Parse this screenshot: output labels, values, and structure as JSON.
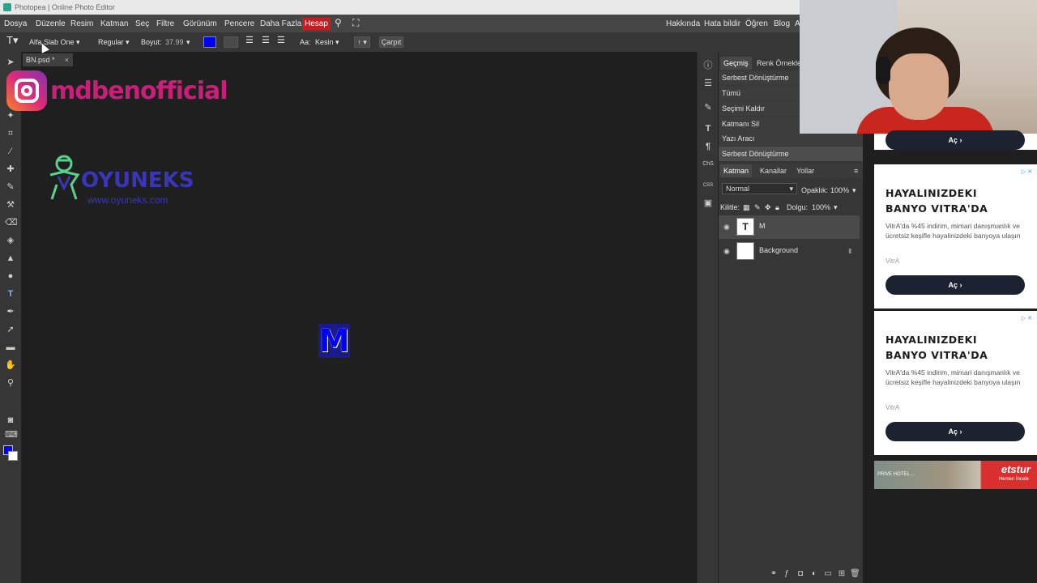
{
  "window": {
    "title": "Photopea | Online Photo Editor"
  },
  "menu": {
    "items": [
      "Dosya",
      "Düzenle",
      "Resim",
      "Katman",
      "Seç",
      "Filtre",
      "Görünüm",
      "Pencere",
      "Daha Fazla",
      "Hesap"
    ],
    "right_items": [
      "Hakkında",
      "Hata bildir",
      "Öğren",
      "Blog",
      "A"
    ],
    "active_color": "#c41e23"
  },
  "options": {
    "font": "Alfa Slab One",
    "style": "Regular",
    "size_label": "Boyut:",
    "size_value": "37.99",
    "text_color": "#0000ff",
    "more": "...",
    "aa_label": "Aa:",
    "aa_value": "Kesin",
    "warp_value": "↑",
    "cancel": "Çarpıt"
  },
  "document": {
    "tab_name": "BN.psd *",
    "close": "×",
    "canvas_text": "M",
    "text_color": "#0000ff"
  },
  "watermark": {
    "instagram": "mdbenofficial",
    "logo_name": "OYUNEKS",
    "logo_url": "www.oyuneks.com"
  },
  "panels": {
    "top_tabs": [
      "Geçmiş",
      "Renk Örnekle"
    ],
    "history": [
      "Serbest Dönüştürme",
      "Tümü",
      "Seçimi Kaldır",
      "Katmanı Sil",
      "Yazı Aracı",
      "Serbest Dönüştürme"
    ],
    "layer_tabs": [
      "Katman",
      "Kanallar",
      "Yollar"
    ],
    "blend_mode": "Normal",
    "opacity_label": "Opaklık:",
    "opacity_value": "100%",
    "lock_label": "Kilitle:",
    "fill_label": "Dolgu:",
    "fill_value": "100%",
    "layers": [
      {
        "name": "M",
        "type": "text",
        "selected": true
      },
      {
        "name": "Background",
        "type": "raster",
        "locked": true
      }
    ]
  },
  "ads": [
    {
      "title": "HAYALINIZDEKI\nBANYO VITRA'DA",
      "desc": "VitrA'da %45 indirim, mimari danışmanlık ve ücretsiz keşifle hayalinizdeki banyoya ulaşın",
      "brand": "VitrA",
      "cta": "Aç"
    },
    {
      "title": "HAYALINIZDEKI\nBANYO VITRA'DA",
      "desc": "VitrA'da %45 indirim, mimari danışmanlık ve ücretsiz keşifle hayalinizdeki banyoya ulaşın",
      "brand": "VitrA",
      "cta": "Aç"
    }
  ],
  "ad_top_cta": "Aç",
  "banner": {
    "text": "PRIVE HOTEL ...",
    "brand": "etstur",
    "cta": "Hemen İncele"
  },
  "strip_labels": {
    "chs": "ChS",
    "css": "CSS"
  }
}
